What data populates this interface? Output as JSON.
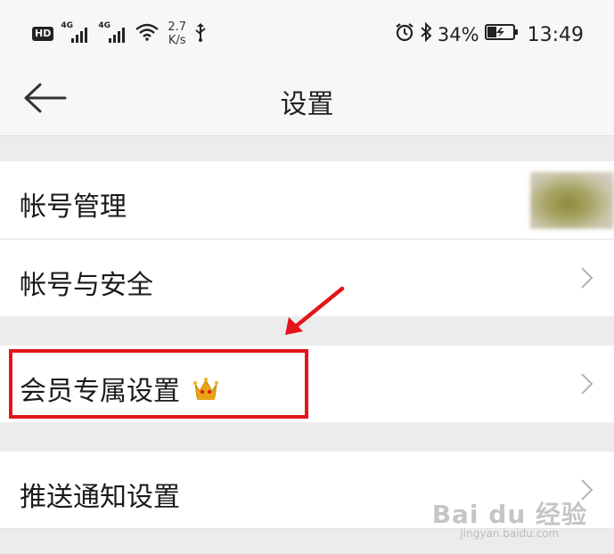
{
  "status_bar": {
    "hd": "HD",
    "net1": "4G",
    "net2": "4G",
    "speed_value": "2.7",
    "speed_unit": "K/s",
    "battery_percent": "34%",
    "time": "13:49"
  },
  "header": {
    "title": "设置"
  },
  "rows": [
    {
      "label": "帐号管理"
    },
    {
      "label": "帐号与安全"
    },
    {
      "label": "会员专属设置"
    },
    {
      "label": "推送通知设置"
    }
  ],
  "watermark": {
    "logo": "Bai du 经验",
    "url": "jingyan.baidu.com"
  },
  "colors": {
    "highlight": "#e3141b",
    "crown": "#e8a317",
    "background": "#ececec"
  },
  "icons": [
    "back-arrow-icon",
    "chevron-right-icon",
    "crown-icon",
    "alarm-icon",
    "bluetooth-icon",
    "battery-icon",
    "wifi-icon",
    "usb-icon",
    "signal-icon"
  ]
}
